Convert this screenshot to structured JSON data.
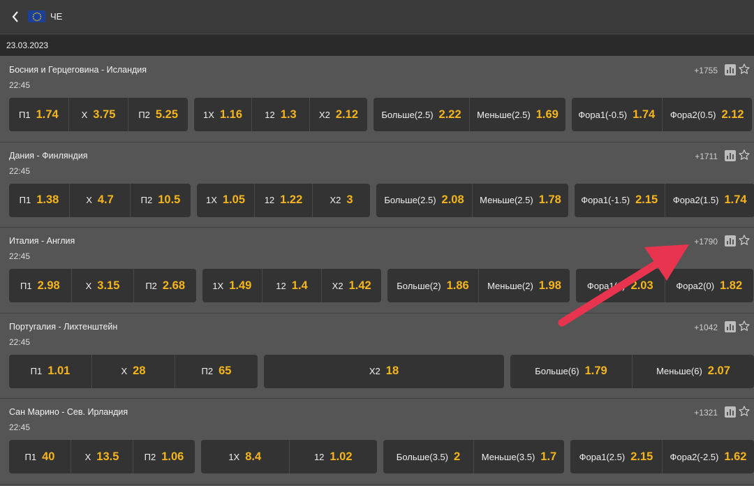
{
  "header": {
    "back_icon": "chevron-left-icon",
    "flag_icon": "eu-flag-icon",
    "title": "ЧЕ"
  },
  "date": "23.03.2023",
  "colors": {
    "accent": "#f5b51b",
    "arrow": "#e8344e"
  },
  "events": [
    {
      "name": "Босния и Герцеговина - Исландия",
      "time": "22:45",
      "count": "+1755",
      "groups": [
        [
          {
            "label": "П1",
            "odd": "1.74"
          },
          {
            "label": "Х",
            "odd": "3.75"
          },
          {
            "label": "П2",
            "odd": "5.25"
          }
        ],
        [
          {
            "label": "1Х",
            "odd": "1.16"
          },
          {
            "label": "12",
            "odd": "1.3"
          },
          {
            "label": "Х2",
            "odd": "2.12"
          }
        ],
        [
          {
            "label": "Больше(2.5)",
            "odd": "2.22"
          },
          {
            "label": "Меньше(2.5)",
            "odd": "1.69"
          }
        ],
        [
          {
            "label": "Фора1(-0.5)",
            "odd": "1.74"
          },
          {
            "label": "Фора2(0.5)",
            "odd": "2.12"
          }
        ]
      ]
    },
    {
      "name": "Дания - Финляндия",
      "time": "22:45",
      "count": "+1711",
      "groups": [
        [
          {
            "label": "П1",
            "odd": "1.38"
          },
          {
            "label": "Х",
            "odd": "4.7"
          },
          {
            "label": "П2",
            "odd": "10.5"
          }
        ],
        [
          {
            "label": "1Х",
            "odd": "1.05"
          },
          {
            "label": "12",
            "odd": "1.22"
          },
          {
            "label": "Х2",
            "odd": "3"
          }
        ],
        [
          {
            "label": "Больше(2.5)",
            "odd": "2.08"
          },
          {
            "label": "Меньше(2.5)",
            "odd": "1.78"
          }
        ],
        [
          {
            "label": "Фора1(-1.5)",
            "odd": "2.15"
          },
          {
            "label": "Фора2(1.5)",
            "odd": "1.74"
          }
        ]
      ]
    },
    {
      "name": "Италия - Англия",
      "time": "22:45",
      "count": "+1790",
      "groups": [
        [
          {
            "label": "П1",
            "odd": "2.98"
          },
          {
            "label": "Х",
            "odd": "3.15"
          },
          {
            "label": "П2",
            "odd": "2.68"
          }
        ],
        [
          {
            "label": "1Х",
            "odd": "1.49"
          },
          {
            "label": "12",
            "odd": "1.4"
          },
          {
            "label": "Х2",
            "odd": "1.42"
          }
        ],
        [
          {
            "label": "Больше(2)",
            "odd": "1.86"
          },
          {
            "label": "Меньше(2)",
            "odd": "1.98"
          }
        ],
        [
          {
            "label": "Фора1(0)",
            "odd": "2.03"
          },
          {
            "label": "Фора2(0)",
            "odd": "1.82"
          }
        ]
      ]
    },
    {
      "name": "Португалия - Лихтенштейн",
      "time": "22:45",
      "count": "+1042",
      "groups": [
        [
          {
            "label": "П1",
            "odd": "1.01"
          },
          {
            "label": "Х",
            "odd": "28"
          },
          {
            "label": "П2",
            "odd": "65"
          }
        ],
        [
          {
            "label": "Х2",
            "odd": "18"
          }
        ],
        [
          {
            "label": "Больше(6)",
            "odd": "1.79"
          },
          {
            "label": "Меньше(6)",
            "odd": "2.07"
          }
        ]
      ]
    },
    {
      "name": "Сан Марино - Сев. Ирландия",
      "time": "22:45",
      "count": "+1321",
      "groups": [
        [
          {
            "label": "П1",
            "odd": "40"
          },
          {
            "label": "Х",
            "odd": "13.5"
          },
          {
            "label": "П2",
            "odd": "1.06"
          }
        ],
        [
          {
            "label": "1Х",
            "odd": "8.4"
          },
          {
            "label": "12",
            "odd": "1.02"
          }
        ],
        [
          {
            "label": "Больше(3.5)",
            "odd": "2"
          },
          {
            "label": "Меньше(3.5)",
            "odd": "1.7"
          }
        ],
        [
          {
            "label": "Фора1(2.5)",
            "odd": "2.15"
          },
          {
            "label": "Фора2(-2.5)",
            "odd": "1.62"
          }
        ]
      ]
    }
  ]
}
